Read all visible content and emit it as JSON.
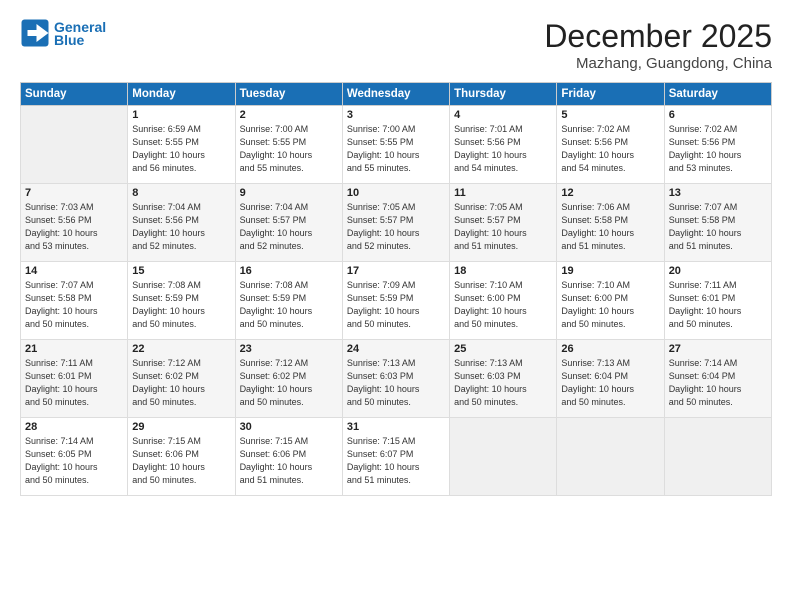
{
  "header": {
    "logo_line1": "General",
    "logo_line2": "Blue",
    "month": "December 2025",
    "location": "Mazhang, Guangdong, China"
  },
  "weekdays": [
    "Sunday",
    "Monday",
    "Tuesday",
    "Wednesday",
    "Thursday",
    "Friday",
    "Saturday"
  ],
  "weeks": [
    [
      {
        "day": "",
        "info": ""
      },
      {
        "day": "1",
        "info": "Sunrise: 6:59 AM\nSunset: 5:55 PM\nDaylight: 10 hours\nand 56 minutes."
      },
      {
        "day": "2",
        "info": "Sunrise: 7:00 AM\nSunset: 5:55 PM\nDaylight: 10 hours\nand 55 minutes."
      },
      {
        "day": "3",
        "info": "Sunrise: 7:00 AM\nSunset: 5:55 PM\nDaylight: 10 hours\nand 55 minutes."
      },
      {
        "day": "4",
        "info": "Sunrise: 7:01 AM\nSunset: 5:56 PM\nDaylight: 10 hours\nand 54 minutes."
      },
      {
        "day": "5",
        "info": "Sunrise: 7:02 AM\nSunset: 5:56 PM\nDaylight: 10 hours\nand 54 minutes."
      },
      {
        "day": "6",
        "info": "Sunrise: 7:02 AM\nSunset: 5:56 PM\nDaylight: 10 hours\nand 53 minutes."
      }
    ],
    [
      {
        "day": "7",
        "info": "Sunrise: 7:03 AM\nSunset: 5:56 PM\nDaylight: 10 hours\nand 53 minutes."
      },
      {
        "day": "8",
        "info": "Sunrise: 7:04 AM\nSunset: 5:56 PM\nDaylight: 10 hours\nand 52 minutes."
      },
      {
        "day": "9",
        "info": "Sunrise: 7:04 AM\nSunset: 5:57 PM\nDaylight: 10 hours\nand 52 minutes."
      },
      {
        "day": "10",
        "info": "Sunrise: 7:05 AM\nSunset: 5:57 PM\nDaylight: 10 hours\nand 52 minutes."
      },
      {
        "day": "11",
        "info": "Sunrise: 7:05 AM\nSunset: 5:57 PM\nDaylight: 10 hours\nand 51 minutes."
      },
      {
        "day": "12",
        "info": "Sunrise: 7:06 AM\nSunset: 5:58 PM\nDaylight: 10 hours\nand 51 minutes."
      },
      {
        "day": "13",
        "info": "Sunrise: 7:07 AM\nSunset: 5:58 PM\nDaylight: 10 hours\nand 51 minutes."
      }
    ],
    [
      {
        "day": "14",
        "info": "Sunrise: 7:07 AM\nSunset: 5:58 PM\nDaylight: 10 hours\nand 50 minutes."
      },
      {
        "day": "15",
        "info": "Sunrise: 7:08 AM\nSunset: 5:59 PM\nDaylight: 10 hours\nand 50 minutes."
      },
      {
        "day": "16",
        "info": "Sunrise: 7:08 AM\nSunset: 5:59 PM\nDaylight: 10 hours\nand 50 minutes."
      },
      {
        "day": "17",
        "info": "Sunrise: 7:09 AM\nSunset: 5:59 PM\nDaylight: 10 hours\nand 50 minutes."
      },
      {
        "day": "18",
        "info": "Sunrise: 7:10 AM\nSunset: 6:00 PM\nDaylight: 10 hours\nand 50 minutes."
      },
      {
        "day": "19",
        "info": "Sunrise: 7:10 AM\nSunset: 6:00 PM\nDaylight: 10 hours\nand 50 minutes."
      },
      {
        "day": "20",
        "info": "Sunrise: 7:11 AM\nSunset: 6:01 PM\nDaylight: 10 hours\nand 50 minutes."
      }
    ],
    [
      {
        "day": "21",
        "info": "Sunrise: 7:11 AM\nSunset: 6:01 PM\nDaylight: 10 hours\nand 50 minutes."
      },
      {
        "day": "22",
        "info": "Sunrise: 7:12 AM\nSunset: 6:02 PM\nDaylight: 10 hours\nand 50 minutes."
      },
      {
        "day": "23",
        "info": "Sunrise: 7:12 AM\nSunset: 6:02 PM\nDaylight: 10 hours\nand 50 minutes."
      },
      {
        "day": "24",
        "info": "Sunrise: 7:13 AM\nSunset: 6:03 PM\nDaylight: 10 hours\nand 50 minutes."
      },
      {
        "day": "25",
        "info": "Sunrise: 7:13 AM\nSunset: 6:03 PM\nDaylight: 10 hours\nand 50 minutes."
      },
      {
        "day": "26",
        "info": "Sunrise: 7:13 AM\nSunset: 6:04 PM\nDaylight: 10 hours\nand 50 minutes."
      },
      {
        "day": "27",
        "info": "Sunrise: 7:14 AM\nSunset: 6:04 PM\nDaylight: 10 hours\nand 50 minutes."
      }
    ],
    [
      {
        "day": "28",
        "info": "Sunrise: 7:14 AM\nSunset: 6:05 PM\nDaylight: 10 hours\nand 50 minutes."
      },
      {
        "day": "29",
        "info": "Sunrise: 7:15 AM\nSunset: 6:06 PM\nDaylight: 10 hours\nand 50 minutes."
      },
      {
        "day": "30",
        "info": "Sunrise: 7:15 AM\nSunset: 6:06 PM\nDaylight: 10 hours\nand 51 minutes."
      },
      {
        "day": "31",
        "info": "Sunrise: 7:15 AM\nSunset: 6:07 PM\nDaylight: 10 hours\nand 51 minutes."
      },
      {
        "day": "",
        "info": ""
      },
      {
        "day": "",
        "info": ""
      },
      {
        "day": "",
        "info": ""
      }
    ]
  ]
}
